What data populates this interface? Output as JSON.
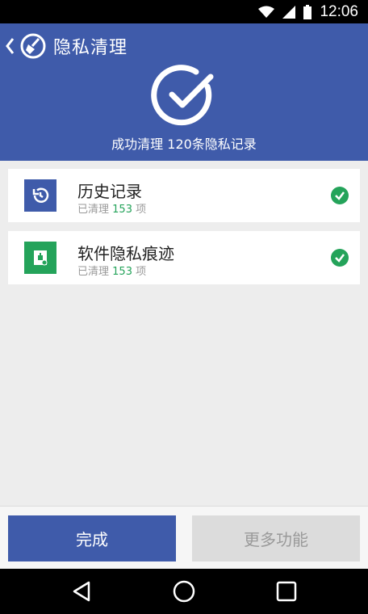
{
  "status_bar": {
    "time": "12:06"
  },
  "header": {
    "title": "隐私清理",
    "summary": "成功清理 120条隐私记录"
  },
  "items": [
    {
      "title": "历史记录",
      "prefix": "已清理",
      "count": "153",
      "unit": "项",
      "icon": "history-icon",
      "icon_color": "#3f5baa"
    },
    {
      "title": "软件隐私痕迹",
      "prefix": "已清理",
      "count": "153",
      "unit": "项",
      "icon": "app-privacy-icon",
      "icon_color": "#24a35a"
    }
  ],
  "footer": {
    "done_label": "完成",
    "more_label": "更多功能"
  },
  "colors": {
    "primary": "#3f5baa",
    "success": "#24a35a",
    "disabled": "#dcdcdc"
  }
}
